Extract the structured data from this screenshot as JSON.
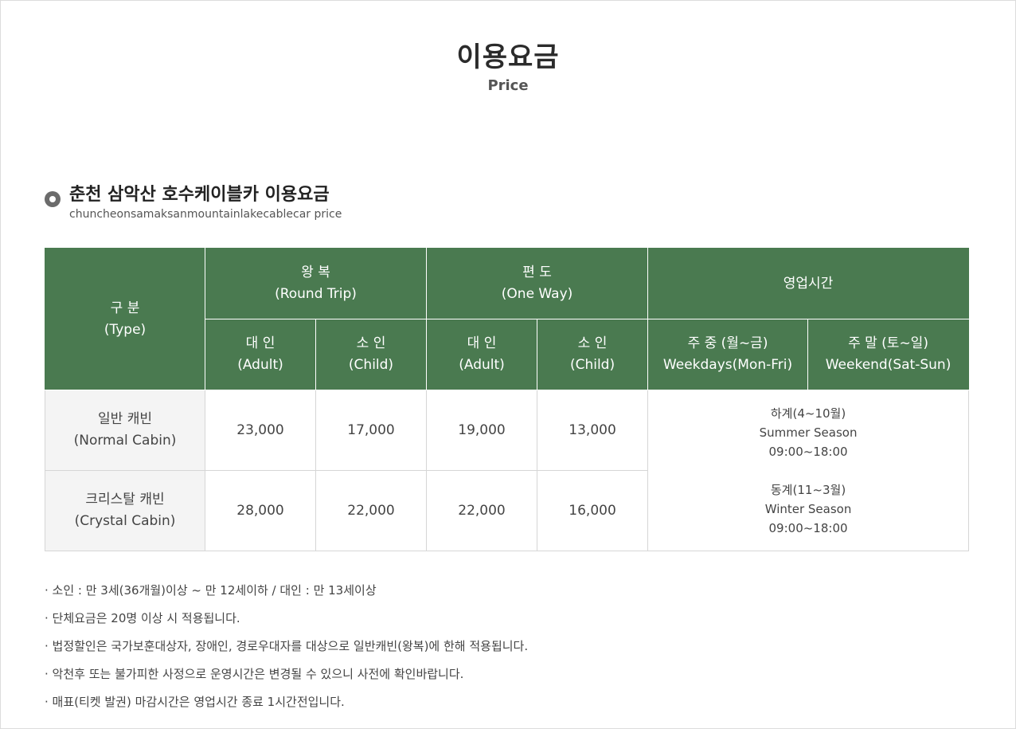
{
  "header": {
    "title": "이용요금",
    "subtitle": "Price"
  },
  "section": {
    "title": "춘천 삼악산 호수케이블카 이용요금",
    "subtitle": "chuncheonsamaksanmountainlakecablecar price"
  },
  "table": {
    "type_header": {
      "ko": "구 분",
      "en": "(Type)"
    },
    "round_trip_header": {
      "ko": "왕 복",
      "en": "(Round Trip)"
    },
    "one_way_header": {
      "ko": "편 도",
      "en": "(One Way)"
    },
    "hours_header": "영업시간",
    "adult_header": {
      "ko": "대 인",
      "en": "(Adult)"
    },
    "child_header": {
      "ko": "소 인",
      "en": "(Child)"
    },
    "weekdays_header": {
      "ko": "주 중 (월~금)",
      "en": "Weekdays(Mon-Fri)"
    },
    "weekend_header": {
      "ko": "주 말 (토~일)",
      "en": "Weekend(Sat-Sun)"
    },
    "rows": [
      {
        "type_ko": "일반 캐빈",
        "type_en": "(Normal Cabin)",
        "round_adult": "23,000",
        "round_child": "17,000",
        "oneway_adult": "19,000",
        "oneway_child": "13,000"
      },
      {
        "type_ko": "크리스탈 캐빈",
        "type_en": "(Crystal Cabin)",
        "round_adult": "28,000",
        "round_child": "22,000",
        "oneway_adult": "22,000",
        "oneway_child": "16,000"
      }
    ],
    "hours": {
      "summer": {
        "label": "하계(4~10월)",
        "season": "Summer Season",
        "time": "09:00~18:00"
      },
      "winter": {
        "label": "동계(11~3월)",
        "season": "Winter Season",
        "time": "09:00~18:00"
      }
    }
  },
  "notes": [
    "· 소인 : 만 3세(36개월)이상 ~ 만 12세이하 / 대인 : 만 13세이상",
    "· 단체요금은 20명 이상 시 적용됩니다.",
    "· 법정할인은 국가보훈대상자, 장애인, 경로우대자를 대상으로 일반캐빈(왕복)에 한해 적용됩니다.",
    "· 악천후 또는 불가피한 사정으로 운영시간은 변경될 수 있으니 사전에 확인바랍니다.",
    "· 매표(티켓 발권) 마감시간은 영업시간 종료 1시간전입니다."
  ],
  "colors": {
    "header_bg": "#4a7a50",
    "type_cell_bg": "#f4f4f4"
  }
}
